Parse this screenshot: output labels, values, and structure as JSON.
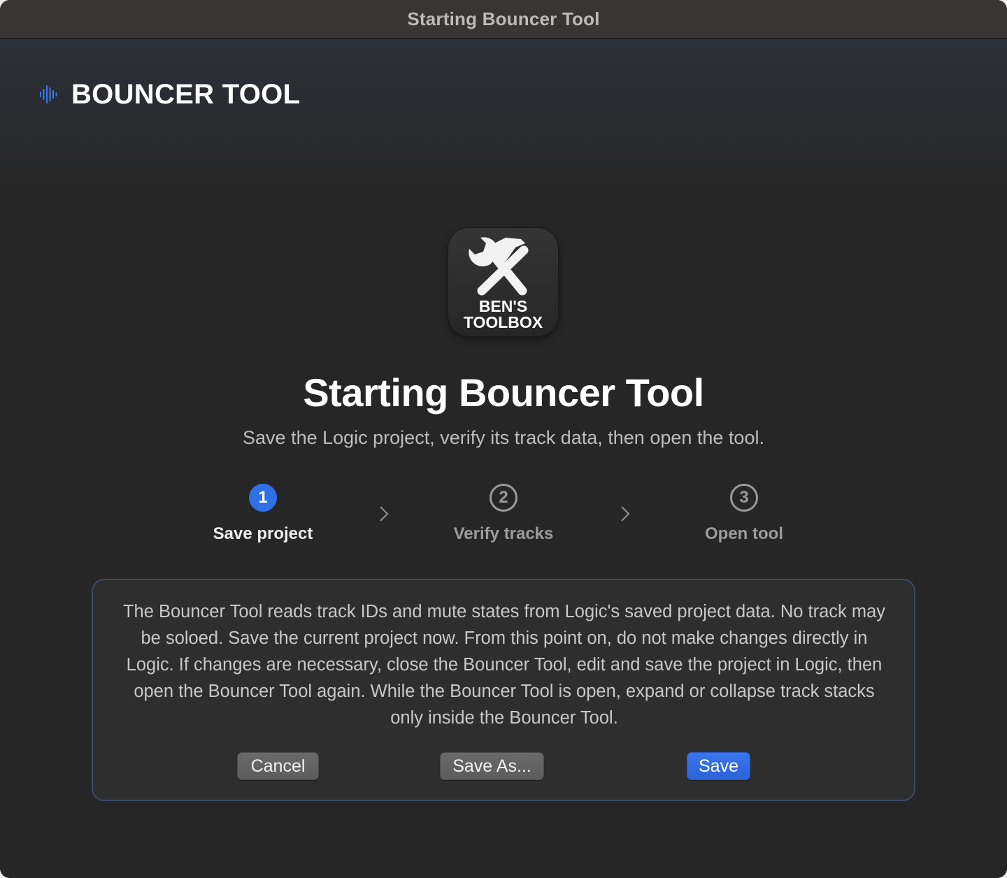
{
  "window": {
    "title": "Starting Bouncer Tool"
  },
  "brand": {
    "title": "BOUNCER TOOL",
    "icon": "waveform-icon",
    "accent": "#3b7bf0"
  },
  "app_icon": {
    "line1": "BEN'S",
    "line2": "TOOLBOX",
    "icon": "wrench-hammer-icon"
  },
  "heading": "Starting Bouncer Tool",
  "subheading": "Save the Logic project, verify its track data, then open the tool.",
  "steps": [
    {
      "number": "1",
      "label": "Save project",
      "state": "active"
    },
    {
      "number": "2",
      "label": "Verify tracks",
      "state": "inactive"
    },
    {
      "number": "3",
      "label": "Open tool",
      "state": "inactive"
    }
  ],
  "panel": {
    "text": "The Bouncer Tool reads track IDs and mute states from Logic's saved project data. No track may be soloed. Save the current project now. From this point on, do not make changes directly in Logic. If changes are necessary, close the Bouncer Tool, edit and save the project in Logic, then open the Bouncer Tool again. While the Bouncer Tool is open, expand or collapse track stacks only inside the Bouncer Tool.",
    "buttons": {
      "cancel": "Cancel",
      "save_as": "Save As...",
      "save": "Save"
    }
  },
  "colors": {
    "primary": "#2f6fe8",
    "background": "#262626",
    "titlebar": "#383634"
  }
}
